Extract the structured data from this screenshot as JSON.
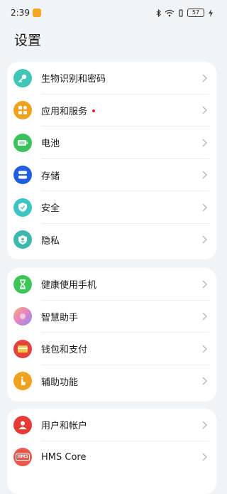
{
  "status_bar": {
    "time": "2:39",
    "battery": "57",
    "icons": [
      "bluetooth-icon",
      "wifi-icon",
      "vibrate-icon",
      "battery-icon",
      "charging-icon"
    ]
  },
  "page": {
    "title": "设置"
  },
  "groups": [
    {
      "items": [
        {
          "label": "生物识别和密码",
          "icon": "key-icon",
          "color": "#3fc6b6"
        },
        {
          "label": "应用和服务",
          "icon": "apps-icon",
          "color": "#f0a11e",
          "badge_dot": true
        },
        {
          "label": "电池",
          "icon": "battery-icon",
          "color": "#3cc25c"
        },
        {
          "label": "存储",
          "icon": "storage-icon",
          "color": "#1f5ee0"
        },
        {
          "label": "安全",
          "icon": "shield-icon",
          "color": "#3cc6c1"
        },
        {
          "label": "隐私",
          "icon": "privacy-icon",
          "color": "#3bb7ad"
        }
      ]
    },
    {
      "items": [
        {
          "label": "健康使用手机",
          "icon": "hourglass-icon",
          "color": "#3cc65a"
        },
        {
          "label": "智慧助手",
          "icon": "assistant-icon",
          "color": "#e88ac2"
        },
        {
          "label": "钱包和支付",
          "icon": "wallet-icon",
          "color": "#e5423d"
        },
        {
          "label": "辅助功能",
          "icon": "accessibility-icon",
          "color": "#f0a11e"
        }
      ]
    },
    {
      "items": [
        {
          "label": "用户和帐户",
          "icon": "user-icon",
          "color": "#e53b35"
        },
        {
          "label": "HMS Core",
          "icon": "hms-icon",
          "color": "#e85a4f",
          "icon_text": "HMS"
        }
      ]
    }
  ]
}
